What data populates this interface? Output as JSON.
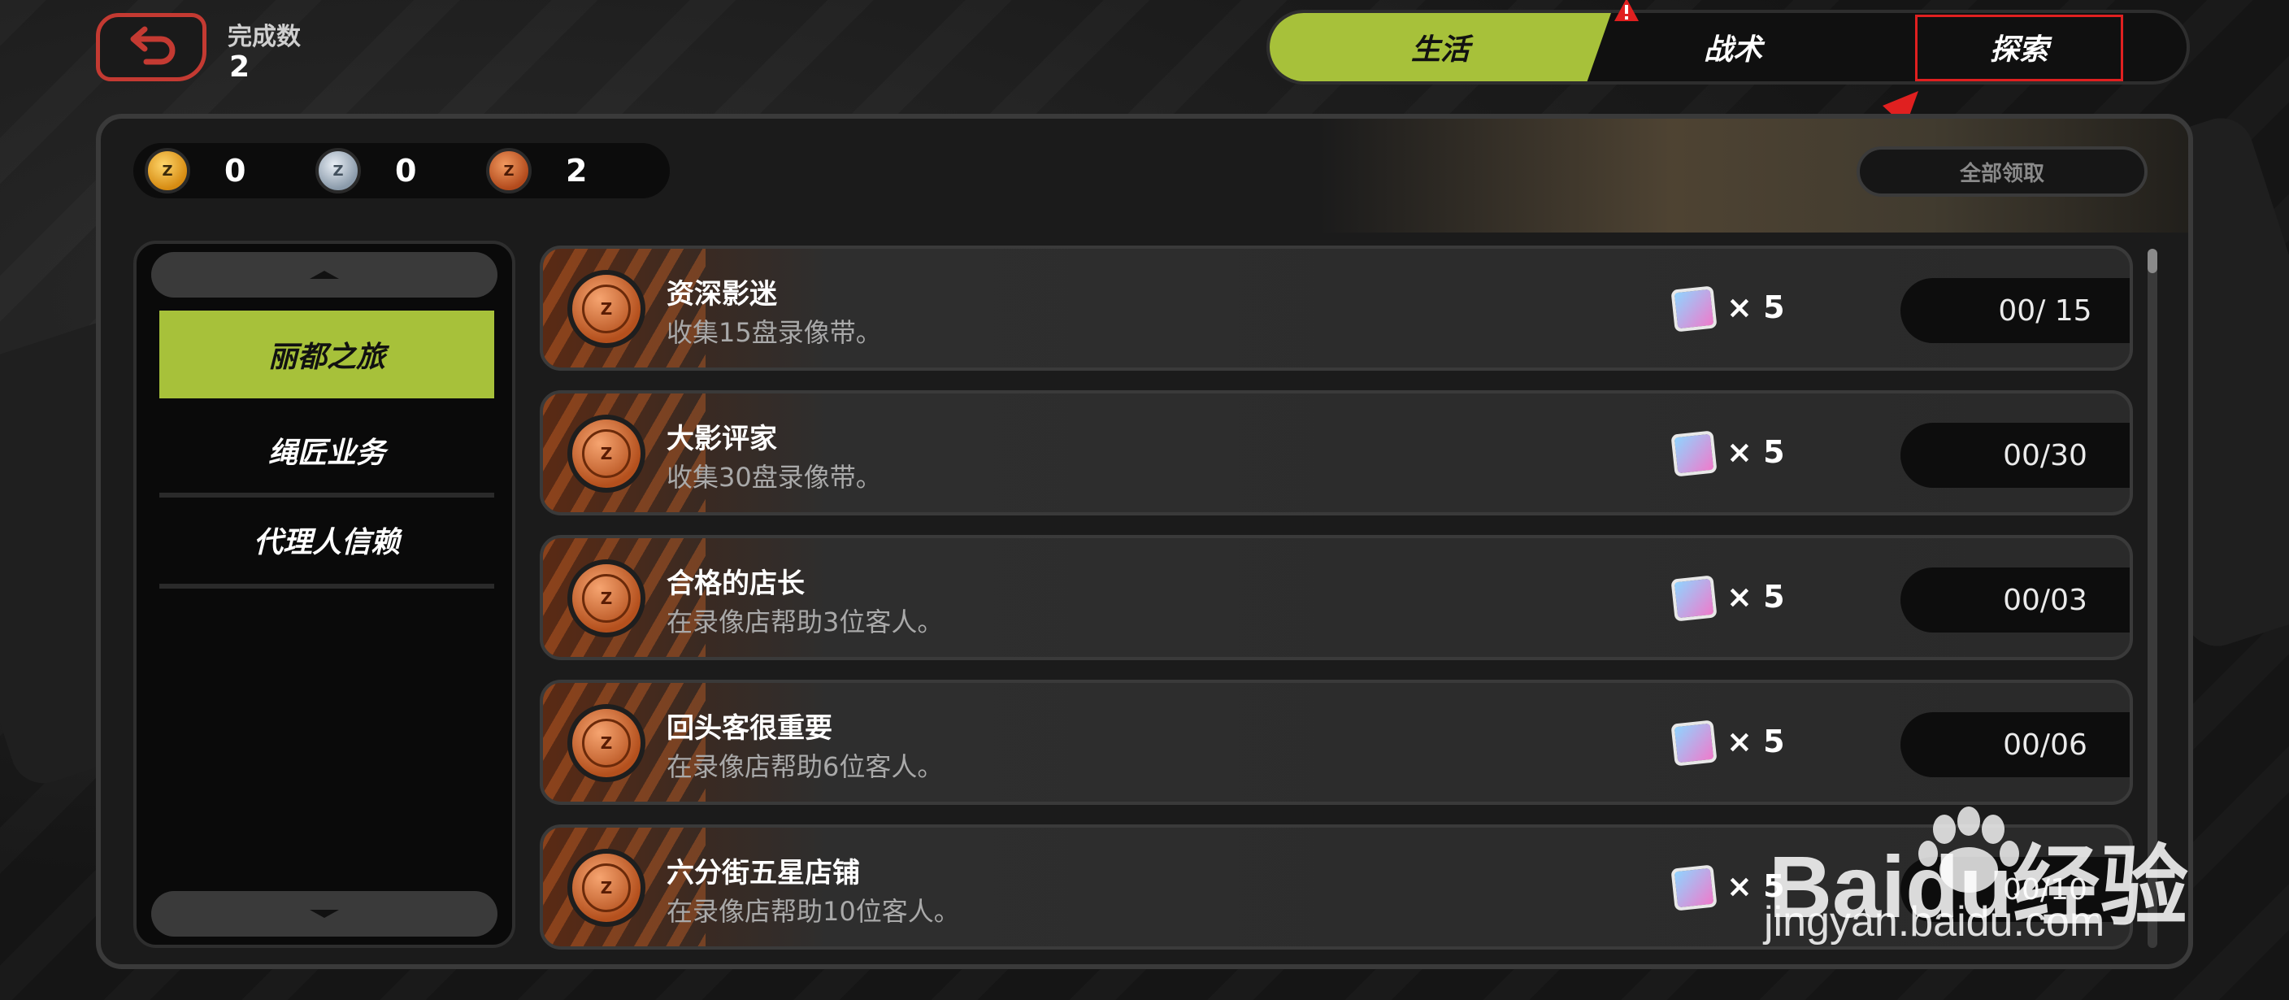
{
  "header": {
    "complete_label": "完成数",
    "complete_value": "2"
  },
  "tabs": [
    {
      "label": "生活",
      "active": true
    },
    {
      "label": "战术",
      "active": false
    },
    {
      "label": "探索",
      "active": false
    }
  ],
  "currency": [
    {
      "type": "gold",
      "count": "0"
    },
    {
      "type": "silver",
      "count": "0"
    },
    {
      "type": "bronze",
      "count": "2"
    }
  ],
  "claim_all_label": "全部领取",
  "sidebar": {
    "items": [
      {
        "label": "丽都之旅",
        "active": true
      },
      {
        "label": "绳匠业务",
        "active": false
      },
      {
        "label": "代理人信赖",
        "active": false
      }
    ]
  },
  "quests": [
    {
      "title": "资深影迷",
      "desc": "收集15盘录像带。",
      "reward_count": "× 5",
      "progress": "00/ 15"
    },
    {
      "title": "大影评家",
      "desc": "收集30盘录像带。",
      "reward_count": "× 5",
      "progress": "00/30"
    },
    {
      "title": "合格的店长",
      "desc": "在录像店帮助3位客人。",
      "reward_count": "× 5",
      "progress": "00/03"
    },
    {
      "title": "回头客很重要",
      "desc": "在录像店帮助6位客人。",
      "reward_count": "× 5",
      "progress": "00/06"
    },
    {
      "title": "六分街五星店铺",
      "desc": "在录像店帮助10位客人。",
      "reward_count": "× 5",
      "progress": "00/10"
    }
  ],
  "watermark": {
    "line1": "Baidu经验",
    "line2": "jingyan.baidu.com"
  },
  "colors": {
    "accent": "#a7c13a",
    "highlight_box": "#e02020",
    "back_button": "#c43a32"
  }
}
